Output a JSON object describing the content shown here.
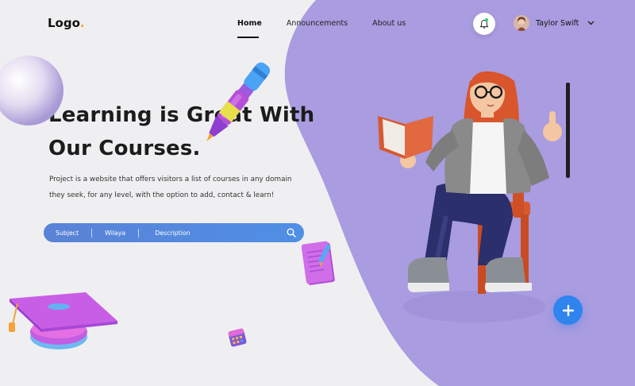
{
  "header": {
    "logo_text": "Logo",
    "logo_dot": ".",
    "nav": [
      {
        "label": "Home",
        "active": true
      },
      {
        "label": "Announcements",
        "active": false
      },
      {
        "label": "About us",
        "active": false
      }
    ],
    "user_name": "Taylor Swift"
  },
  "hero": {
    "title_line1": "Learning is Great With",
    "title_line2": "Our Courses.",
    "description": "Project is a website that offers visitors a list of courses in any domain they seek, for any level, with the option to add, contact & learn!"
  },
  "search": {
    "fields": [
      "Subject",
      "Wilaya",
      "Description"
    ]
  },
  "colors": {
    "accent_blue": "#2f84ee",
    "purple_bg": "#a99ce0",
    "logo_dot": "#f5a623"
  },
  "icons": {
    "bell": "bell-icon",
    "search": "search-icon",
    "plus": "plus-icon",
    "chevron": "chevron-down-icon"
  }
}
